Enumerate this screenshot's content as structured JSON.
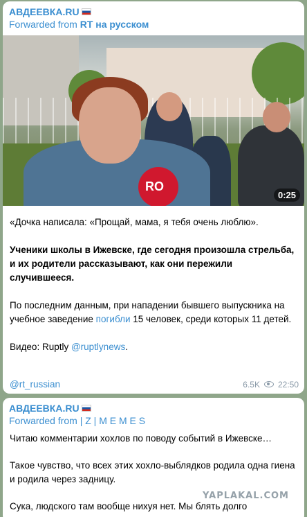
{
  "messages": [
    {
      "channel": "АВДЕЕВКА.RU",
      "forwarded_prefix": "Forwarded from ",
      "forwarded_source": "RT на русском",
      "video_duration": "0:25",
      "mic_logo": "RO",
      "paragraphs": {
        "p1": "«Дочка написала: «Прощай, мама, я тебя очень люблю».",
        "p2": "Ученики школы в Ижевске, где сегодня произошла стрельба, и их родители рассказывают, как они пережили случившееся.",
        "p3_before": "По последним данным, при нападении бывшего выпускника на учебное заведение ",
        "p3_link": "погибли",
        "p3_after": " 15 человек, среди которых 11 детей.",
        "p4_before": "Видео: Ruptly ",
        "p4_link": "@ruptlynews",
        "p4_after": "."
      },
      "tag": "@rt_russian",
      "views": "6.5K",
      "time": "22:50"
    },
    {
      "channel": "АВДЕЕВКА.RU",
      "forwarded_prefix": "Forwarded from ",
      "forwarded_source": "| Z | M E M E S",
      "paragraphs": {
        "p1": "Читаю комментарии хохлов по поводу событий в Ижевске…",
        "p2": "Такое чувство, что всех этих хохло-выблядков родила одна гиена и родила через задницу.",
        "p3": "Сука, людского там вообще нихуя нет. Мы блять долго"
      }
    }
  ],
  "watermark": "YAPLAKAL.COM",
  "colors": {
    "accent": "#3a8ed0",
    "background": "#8fa68a",
    "meta": "#8a9aa8"
  }
}
